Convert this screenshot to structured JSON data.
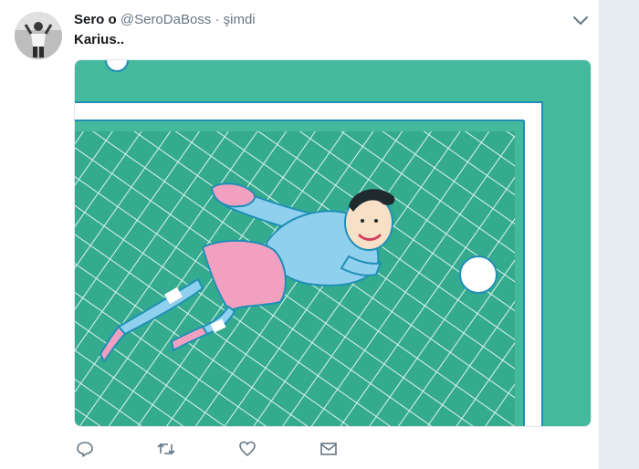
{
  "tweet": {
    "display_name": "Sero o",
    "handle": "@SeroDaBoss",
    "separator": "·",
    "timestamp": "şimdi",
    "text": "Karius..",
    "avatar": "user-avatar-photo",
    "media": "goalkeeper-diving-illustration"
  },
  "actions": [
    {
      "name": "reply",
      "icon": "reply-icon"
    },
    {
      "name": "retweet",
      "icon": "retweet-icon"
    },
    {
      "name": "like",
      "icon": "heart-icon"
    },
    {
      "name": "direct-message",
      "icon": "envelope-icon"
    }
  ],
  "colors": {
    "text_primary": "#14171a",
    "text_secondary": "#657786",
    "icon": "#657786",
    "pitch_green": "#3fb59a",
    "net_green": "#2fa98a",
    "goalkeeper_shirt": "#8fd0ee",
    "goalkeeper_shorts": "#f2a0bf",
    "ball": "#ffffff"
  }
}
